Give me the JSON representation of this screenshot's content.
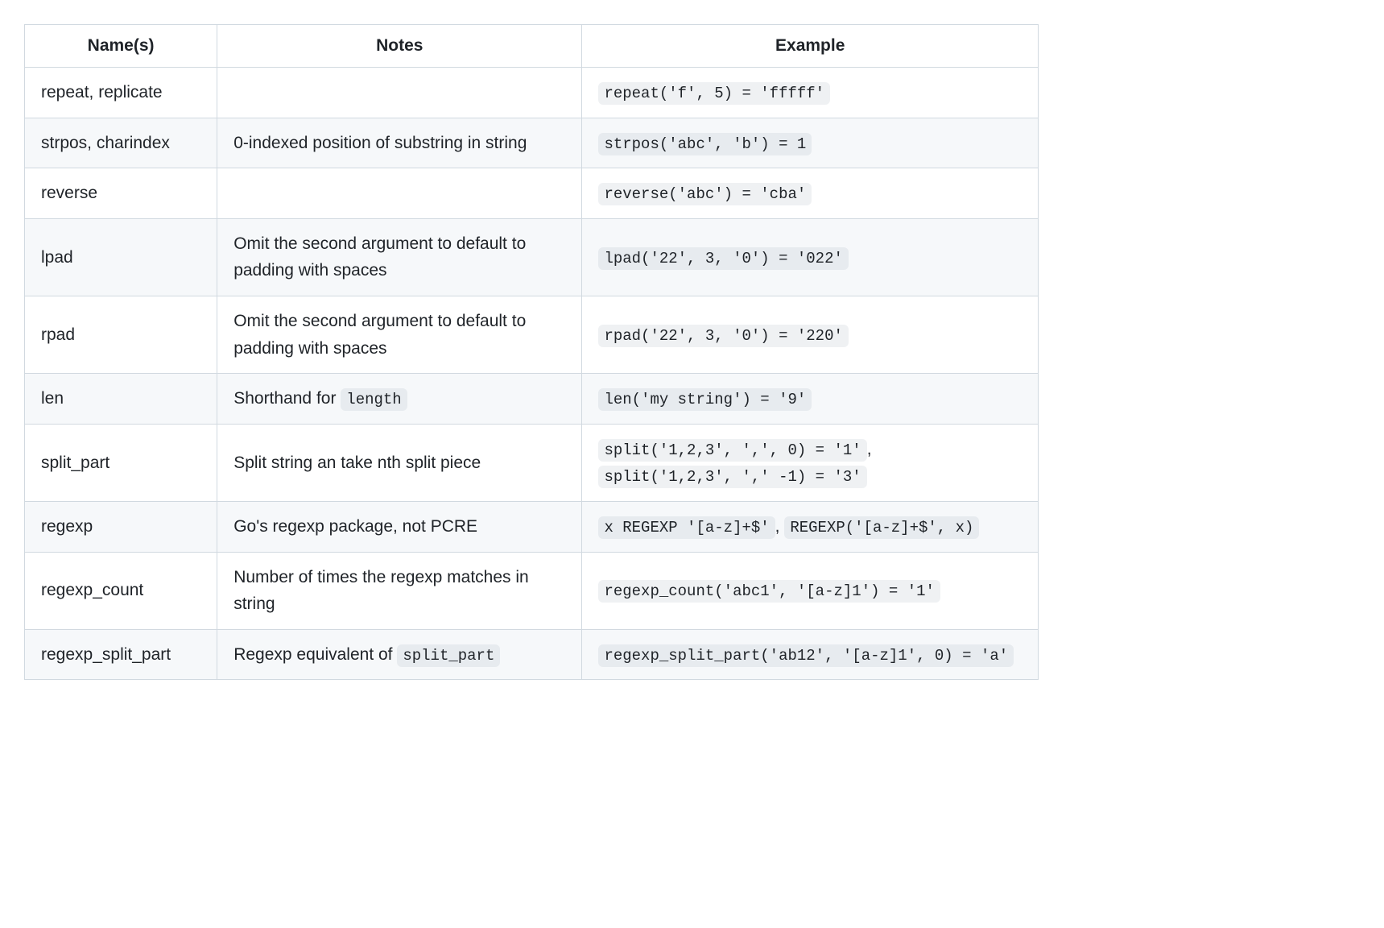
{
  "table": {
    "headers": {
      "name": "Name(s)",
      "notes": "Notes",
      "example": "Example"
    },
    "rows": [
      {
        "name": "repeat, replicate",
        "notes_plain": "",
        "example_codes": [
          "repeat('f', 5) = 'fffff'"
        ]
      },
      {
        "name": "strpos, charindex",
        "notes_plain": "0-indexed position of substring in string",
        "example_codes": [
          "strpos('abc', 'b') = 1"
        ]
      },
      {
        "name": "reverse",
        "notes_plain": "",
        "example_codes": [
          "reverse('abc') = 'cba'"
        ]
      },
      {
        "name": "lpad",
        "notes_plain": "Omit the second argument to default to padding with spaces",
        "example_codes": [
          "lpad('22', 3, '0') = '022'"
        ]
      },
      {
        "name": "rpad",
        "notes_plain": "Omit the second argument to default to padding with spaces",
        "example_codes": [
          "rpad('22', 3, '0') = '220'"
        ]
      },
      {
        "name": "len",
        "notes_prefix": "Shorthand for ",
        "notes_code": "length",
        "example_codes": [
          "len('my string') = '9'"
        ]
      },
      {
        "name": "split_part",
        "notes_plain": "Split string an take nth split piece",
        "example_codes": [
          "split('1,2,3', ',', 0) = '1'",
          "split('1,2,3', ',' -1) = '3'"
        ],
        "example_sep": ", "
      },
      {
        "name": "regexp",
        "notes_plain": "Go's regexp package, not PCRE",
        "example_codes": [
          "x REGEXP '[a-z]+$'",
          "REGEXP('[a-z]+$', x)"
        ],
        "example_sep": ", "
      },
      {
        "name": "regexp_count",
        "notes_plain": "Number of times the regexp matches in string",
        "example_codes": [
          "regexp_count('abc1', '[a-z]1') = '1'"
        ]
      },
      {
        "name": "regexp_split_part",
        "notes_prefix": "Regexp equivalent of ",
        "notes_code": "split_part",
        "example_codes": [
          "regexp_split_part('ab12', '[a-z]1', 0) = 'a'"
        ]
      }
    ]
  }
}
